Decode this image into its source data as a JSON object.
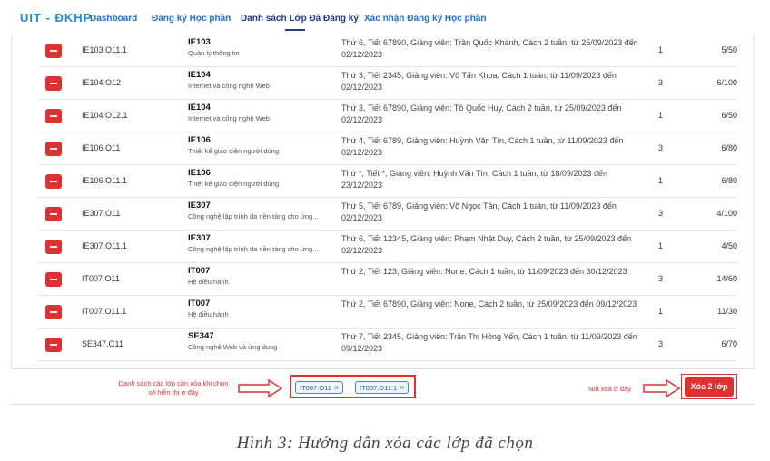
{
  "nav": {
    "brand": "UIT - ĐKHP",
    "items": [
      {
        "label": "Dashboard"
      },
      {
        "label": "Đăng ký Học phần"
      },
      {
        "label": "Danh sách Lớp Đã Đăng ký"
      },
      {
        "label": "Xác nhận Đăng ký Học phần"
      }
    ],
    "active_index": 2
  },
  "rows": [
    {
      "code": "IE103.O11.1",
      "subject_code": "IE103",
      "subject_name": "Quản lý thông tin",
      "schedule": "Thứ 6, Tiết 67890, Giảng viên: Trần Quốc Khánh, Cách 2 tuần, từ 25/09/2023 đến 02/12/2023",
      "credits": "1",
      "capacity": "5/50"
    },
    {
      "code": "IE104.O12",
      "subject_code": "IE104",
      "subject_name": "Internet và công nghệ Web",
      "schedule": "Thứ 3, Tiết 2345, Giảng viên: Võ Tấn Khoa, Cách 1 tuần, từ 11/09/2023 đến 02/12/2023",
      "credits": "3",
      "capacity": "6/100"
    },
    {
      "code": "IE104.O12.1",
      "subject_code": "IE104",
      "subject_name": "Internet và công nghệ Web",
      "schedule": "Thứ 3, Tiết 67890, Giảng viên: Tô Quốc Huy, Cách 2 tuần, từ 25/09/2023 đến 02/12/2023",
      "credits": "1",
      "capacity": "6/50"
    },
    {
      "code": "IE106.O11",
      "subject_code": "IE106",
      "subject_name": "Thiết kế giao diện người dùng",
      "schedule": "Thứ 4, Tiết 6789, Giảng viên: Huỳnh Văn Tín, Cách 1 tuần, từ 11/09/2023 đến 02/12/2023",
      "credits": "3",
      "capacity": "6/80"
    },
    {
      "code": "IE106.O11.1",
      "subject_code": "IE106",
      "subject_name": "Thiết kế giao diện người dùng",
      "schedule": "Thứ *, Tiết *, Giảng viên: Huỳnh Văn Tín, Cách 1 tuần, từ 18/09/2023 đến 23/12/2023",
      "credits": "1",
      "capacity": "6/80"
    },
    {
      "code": "IE307.O11",
      "subject_code": "IE307",
      "subject_name": "Công nghệ lập trình đa nền tảng cho ứng...",
      "schedule": "Thứ 5, Tiết 6789, Giảng viên: Võ Ngọc Tân, Cách 1 tuần, từ 11/09/2023 đến 02/12/2023",
      "credits": "3",
      "capacity": "4/100"
    },
    {
      "code": "IE307.O11.1",
      "subject_code": "IE307",
      "subject_name": "Công nghệ lập trình đa nền tảng cho ứng...",
      "schedule": "Thứ 6, Tiết 12345, Giảng viên: Phạm Nhật Duy, Cách 2 tuần, từ 25/09/2023 đến 02/12/2023",
      "credits": "1",
      "capacity": "4/50"
    },
    {
      "code": "IT007.O11",
      "subject_code": "IT007",
      "subject_name": "Hệ điều hành",
      "schedule": "Thứ 2, Tiết 123, Giảng viên: None, Cách 1 tuần, từ 11/09/2023 đến 30/12/2023",
      "credits": "3",
      "capacity": "14/60"
    },
    {
      "code": "IT007.O11.1",
      "subject_code": "IT007",
      "subject_name": "Hệ điều hành",
      "schedule": "Thứ 2, Tiết 67890, Giảng viên: None, Cách 2 tuần, từ 25/09/2023 đến 09/12/2023",
      "credits": "1",
      "capacity": "11/30"
    },
    {
      "code": "SE347.O11",
      "subject_code": "SE347",
      "subject_name": "Công nghệ Web và ứng dụng",
      "schedule": "Thứ 7, Tiết 2345, Giảng viên: Trần Thị Hồng Yến, Cách 1 tuần, từ 11/09/2023 đến 09/12/2023",
      "credits": "3",
      "capacity": "6/70"
    }
  ],
  "selection_bar": {
    "hint_left": "Danh sách các lớp cần xóa khi chọn sẽ hiển thị ở đây",
    "chips": [
      {
        "label": "IT007.O11",
        "remove": "×"
      },
      {
        "label": "IT007.O11.1",
        "remove": "×"
      }
    ],
    "hint_right": "Nút xóa ở đây",
    "delete_button": "Xóa 2 lớp"
  },
  "caption": "Hình 3: Hướng dẫn xóa các lớp đã chọn",
  "colors": {
    "accent": "#1e6fd9",
    "danger": "#e03131"
  }
}
